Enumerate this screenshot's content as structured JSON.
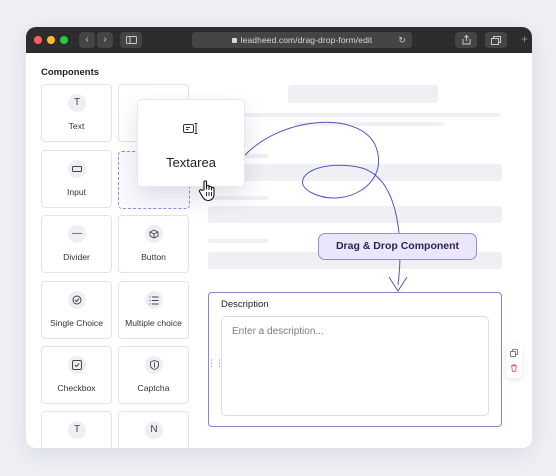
{
  "browser": {
    "url": "leadheed.com/drag-drop-form/edit",
    "back_icon": "chevron-left-icon",
    "forward_icon": "chevron-right-icon",
    "sidebar_icon": "sidebar-toggle-icon",
    "reload_icon": "reload-icon",
    "share_icon": "share-icon",
    "tabs_icon": "tabs-icon",
    "new_tab_icon": "plus-icon",
    "traffic_lights": [
      "#ff5f57",
      "#febc2e",
      "#28c840"
    ]
  },
  "components_panel": {
    "title": "Components",
    "items": [
      {
        "label": "Text",
        "icon": "text-icon"
      },
      {
        "label": "Input",
        "icon": "input-icon"
      },
      {
        "label": "Divider",
        "icon": "divider-icon"
      },
      {
        "label": "Button",
        "icon": "button-icon"
      },
      {
        "label": "Single Choice",
        "icon": "radio-icon"
      },
      {
        "label": "Multiple choice",
        "icon": "list-icon"
      },
      {
        "label": "Checkbox",
        "icon": "checkbox-icon"
      },
      {
        "label": "Captcha",
        "icon": "shield-icon"
      },
      {
        "label": "",
        "icon": "text-icon"
      },
      {
        "label": "",
        "icon": "n-letter-icon"
      }
    ]
  },
  "dragging": {
    "label": "Textarea",
    "icon": "textarea-icon"
  },
  "tooltip": {
    "label": "Drag & Drop Component"
  },
  "description_field": {
    "label": "Description",
    "placeholder": "Enter a description..."
  },
  "colors": {
    "accent": "#8b7fd6",
    "accent_light": "#ebe6fb",
    "delete": "#e5484d"
  }
}
